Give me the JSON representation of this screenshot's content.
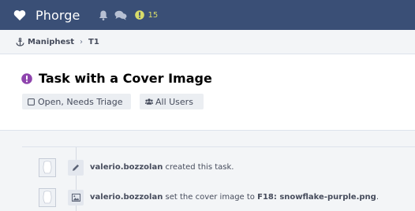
{
  "app": {
    "name": "Phorge",
    "notification_count": "15"
  },
  "breadcrumb": {
    "app": "Maniphest",
    "separator": "›",
    "object": "T1"
  },
  "task": {
    "title": "Task with a Cover Image",
    "status_tag": "Open, Needs Triage",
    "policy_tag": "All Users"
  },
  "timeline": {
    "events": [
      {
        "author": "valerio.bozzolan",
        "action": " created this task.",
        "file": "",
        "suffix": ""
      },
      {
        "author": "valerio.bozzolan",
        "action": " set the cover image to ",
        "file": "F18: snowflake-purple.png",
        "suffix": "."
      }
    ]
  },
  "colors": {
    "topbar": "#3a4f76",
    "status_purple": "#8e44ad",
    "warning_yellow": "#d8dc6a"
  },
  "icons": [
    "heart-icon",
    "bell-icon",
    "chat-icon",
    "warning-icon",
    "anchor-icon",
    "exclamation-circle-icon",
    "square-icon",
    "users-icon",
    "pencil-icon",
    "image-icon",
    "avatar-icon"
  ]
}
